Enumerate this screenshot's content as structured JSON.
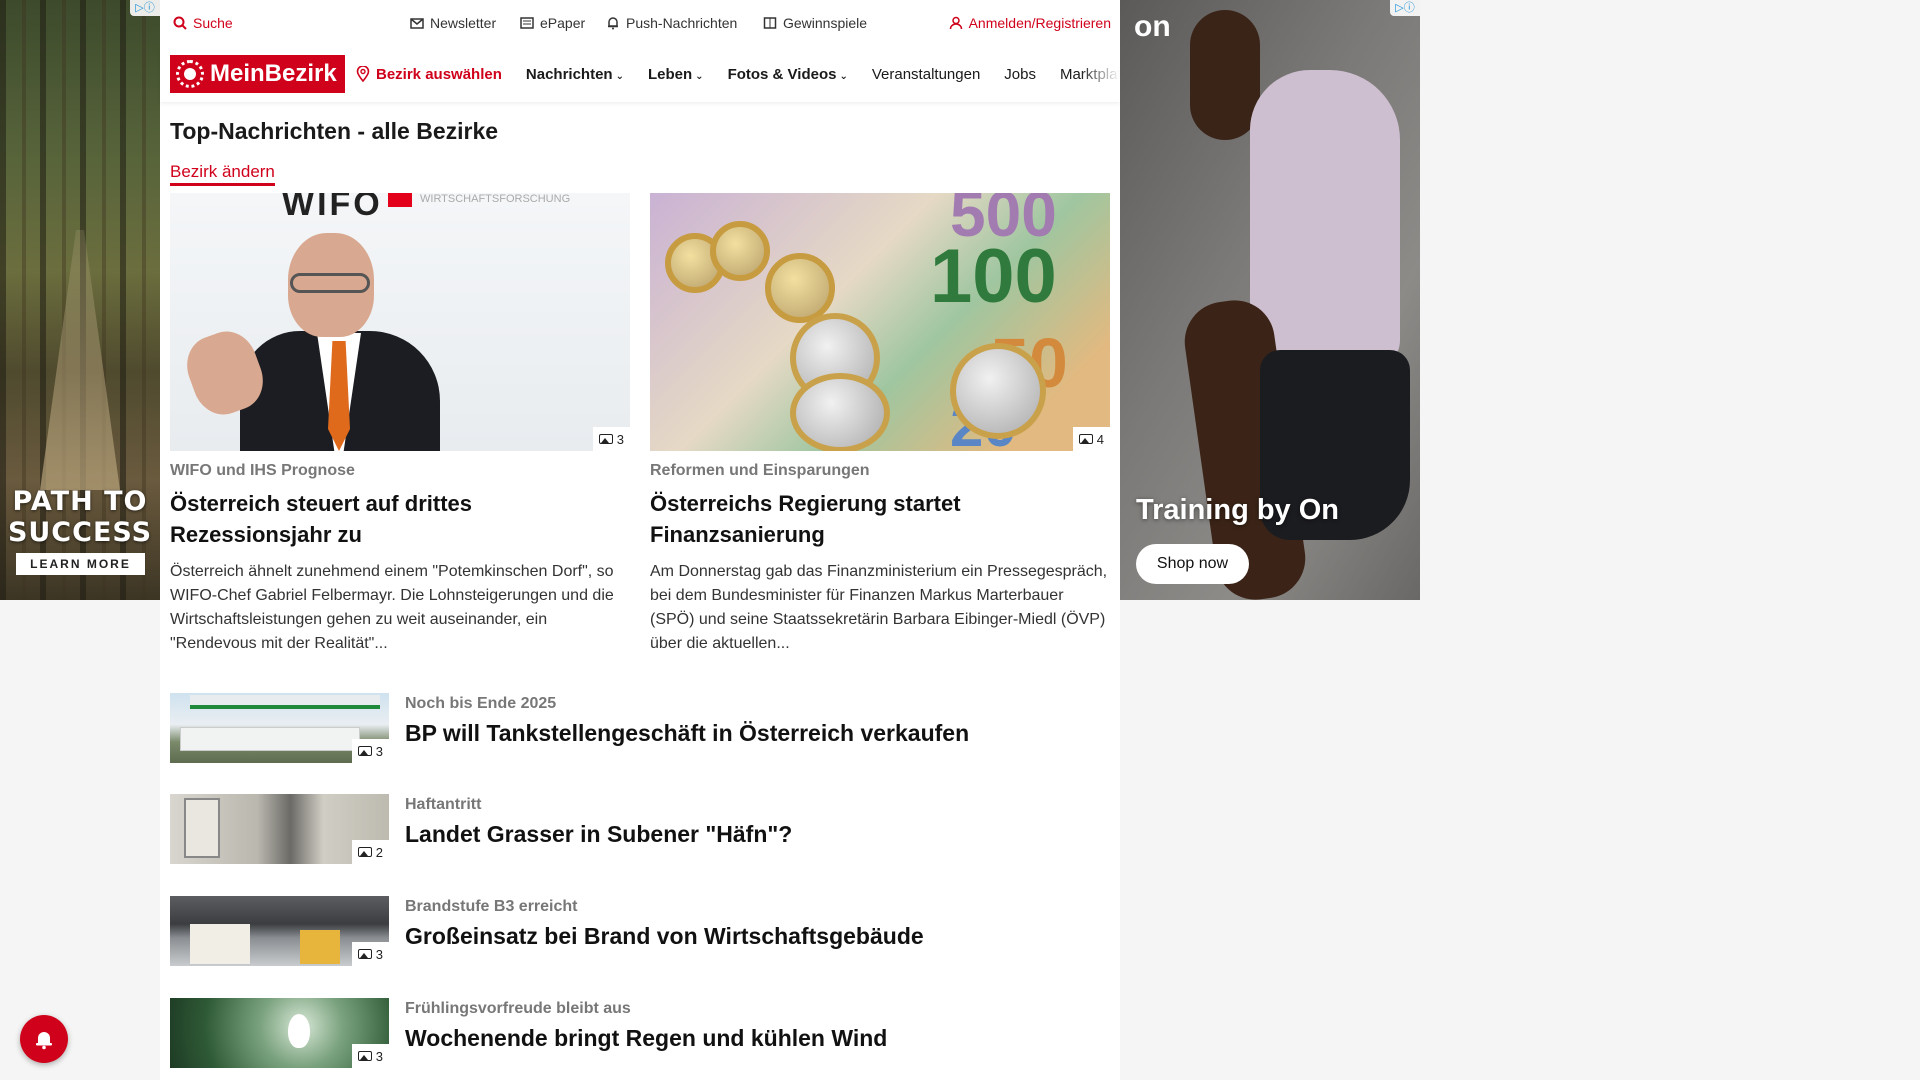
{
  "ads": {
    "left": {
      "title_line1": "PATH TO",
      "title_line2": "SUCCESS",
      "cta": "LEARN MORE",
      "adchoices": "▷ⓘ"
    },
    "right": {
      "brand": "on",
      "tagline": "Training by On",
      "cta": "Shop now",
      "adchoices": "▷ⓘ"
    }
  },
  "topbar": {
    "search": "Suche",
    "newsletter": "Newsletter",
    "epaper": "ePaper",
    "push": "Push-Nachrichten",
    "gewinnspiele": "Gewinnspiele",
    "login": "Anmelden/Registrieren"
  },
  "nav": {
    "logo": "MeinBezirk",
    "bezirk": "Bezirk auswählen",
    "items": [
      "Nachrichten",
      "Leben",
      "Fotos & Videos",
      "Veranstaltungen",
      "Jobs",
      "Marktplatz"
    ]
  },
  "page": {
    "title": "Top-Nachrichten - alle Bezirke",
    "change_link": "Bezirk ändern"
  },
  "featured": [
    {
      "kicker": "WIFO und IHS Prognose",
      "headline": "Österreich steuert auf drittes Rezessionsjahr zu",
      "teaser": "Österreich ähnelt zunehmend einem \"Potemkinschen Dorf\", so WIFO-Chef Gabriel Felbermayr. Die Lohnsteigerungen und die Wirtschaftsleistungen gehen zu weit auseinander, ein \"Rendevous mit der Realität\"...",
      "photo_count": "3",
      "image_text": "WIFO",
      "image_subtext": "WIRTSCHAFTSFORSCHUNG"
    },
    {
      "kicker": "Reformen und Einsparungen",
      "headline": "Österreichs Regierung startet Finanzsanierung",
      "teaser": "Am Donnerstag gab das Finanzministerium ein Pressegespräch, bei dem Bundesminister für Finanzen Markus Marterbauer (SPÖ) und seine Staatssekretärin Barbara Eibinger-Miedl (ÖVP) über die aktuellen...",
      "photo_count": "4",
      "banknotes": [
        "500",
        "100",
        "50",
        "20"
      ]
    }
  ],
  "list": [
    {
      "kicker": "Noch bis Ende 2025",
      "headline": "BP will Tankstellengeschäft in Österreich verkaufen",
      "photo_count": "3"
    },
    {
      "kicker": "Haftantritt",
      "headline": "Landet Grasser in Subener \"Häfn\"?",
      "photo_count": "2"
    },
    {
      "kicker": "Brandstufe B3 erreicht",
      "headline": "Großeinsatz bei Brand von Wirtschaftsgebäude",
      "photo_count": "3"
    },
    {
      "kicker": "Frühlingsvorfreude bleibt aus",
      "headline": "Wochenende bringt Regen und kühlen Wind",
      "photo_count": "3"
    }
  ],
  "colors": {
    "brand_red": "#d0021b"
  }
}
